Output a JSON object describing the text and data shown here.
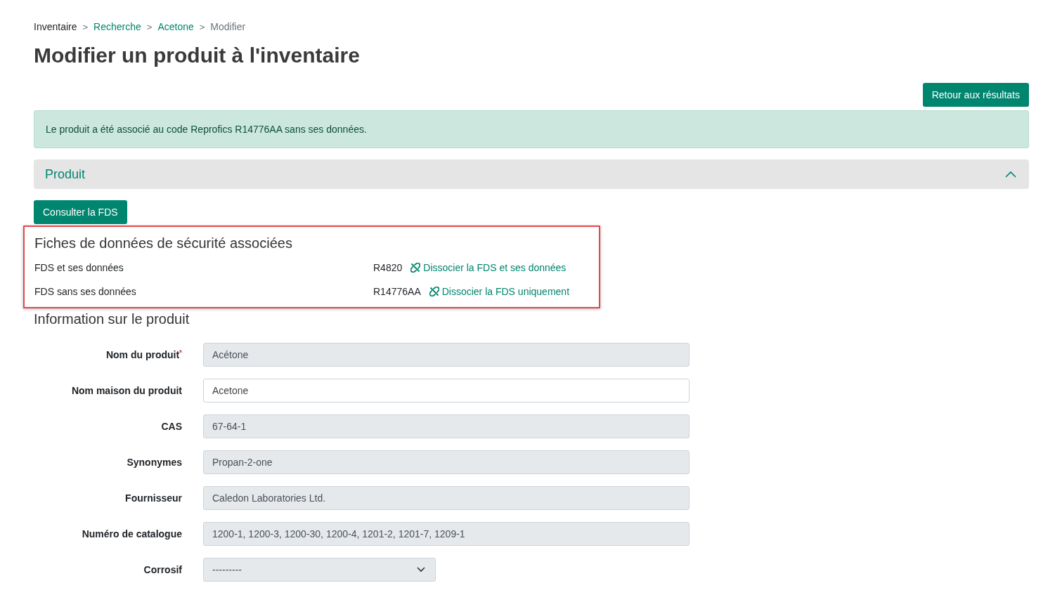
{
  "breadcrumb": [
    {
      "label": "Inventaire",
      "kind": "plain"
    },
    {
      "label": "Recherche",
      "kind": "link"
    },
    {
      "label": "Acetone",
      "kind": "link"
    },
    {
      "label": "Modifier",
      "kind": "current"
    }
  ],
  "breadcrumb_separator": ">",
  "title": "Modifier un produit à l'inventaire",
  "back_button": "Retour aux résultats",
  "alert": "Le produit a été associé au code Reprofics R14776AA sans ses données.",
  "accordion": {
    "label": "Produit",
    "expanded": true
  },
  "consult_button": "Consulter la FDS",
  "sds_section": {
    "title": "Fiches de données de sécurité associées",
    "highlighted": true,
    "rows": [
      {
        "label": "FDS et ses données",
        "code": "R4820",
        "action": "Dissocier la FDS et ses données"
      },
      {
        "label": "FDS sans ses données",
        "code": "R14776AA",
        "action": "Dissocier la FDS uniquement"
      }
    ]
  },
  "product_section": {
    "title": "Information sur le produit",
    "required_mark": "*",
    "fields": [
      {
        "label": "Nom du produit",
        "required": true,
        "kind": "text",
        "value": "Acétone",
        "disabled": true
      },
      {
        "label": "Nom maison du produit",
        "required": false,
        "kind": "text",
        "value": "Acetone",
        "disabled": false
      },
      {
        "label": "CAS",
        "required": false,
        "kind": "text",
        "value": "67-64-1",
        "disabled": true
      },
      {
        "label": "Synonymes",
        "required": false,
        "kind": "text",
        "value": "Propan-2-one",
        "disabled": true
      },
      {
        "label": "Fournisseur",
        "required": false,
        "kind": "text",
        "value": "Caledon Laboratories Ltd.",
        "disabled": true
      },
      {
        "label": "Numéro de catalogue",
        "required": false,
        "kind": "text",
        "value": "1200-1, 1200-3, 1200-30, 1200-4, 1201-2, 1201-7, 1209-1",
        "disabled": true
      },
      {
        "label": "Corrosif",
        "required": false,
        "kind": "select",
        "value": "---------",
        "disabled": true
      }
    ]
  }
}
